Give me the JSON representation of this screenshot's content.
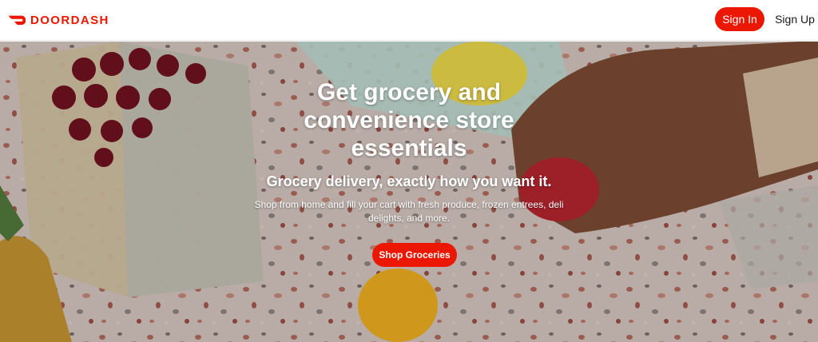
{
  "header": {
    "brand": "DOORDASH",
    "sign_in_label": "Sign In",
    "sign_up_label": "Sign Up",
    "brand_color": "#eb1700"
  },
  "hero": {
    "title_lines": [
      "Get grocery and",
      "convenience store",
      "essentials"
    ],
    "subtitle": "Grocery delivery, exactly how you want it.",
    "description_lines": [
      "Shop from home and fill your cart with fresh produce, frozen entrees, deli",
      "delights, and more."
    ],
    "cta_label": "Shop Groceries",
    "background": "terrazzo-table-with-cherries-pineapple-lemon-and-hand-holding-apple"
  }
}
